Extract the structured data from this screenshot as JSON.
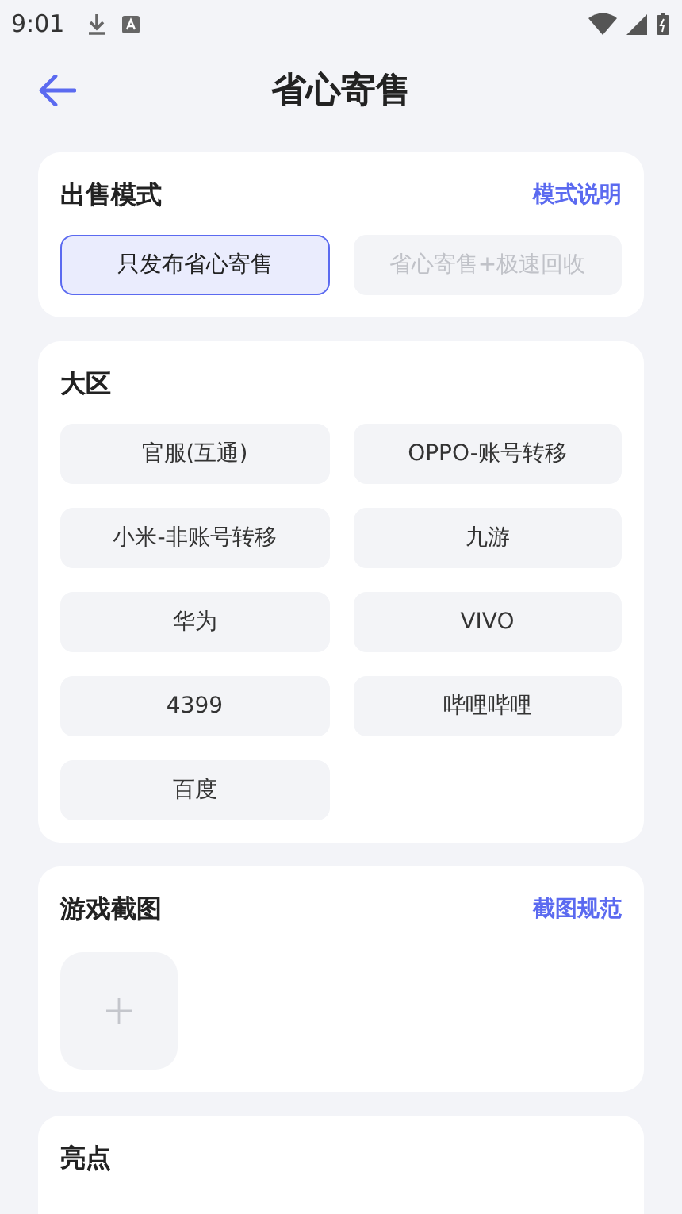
{
  "status_bar": {
    "time": "9:01"
  },
  "header": {
    "title": "省心寄售"
  },
  "sale_mode": {
    "title": "出售模式",
    "link": "模式说明",
    "options": [
      {
        "label": "只发布省心寄售",
        "selected": true
      },
      {
        "label": "省心寄售+极速回收",
        "selected": false
      }
    ]
  },
  "region": {
    "title": "大区",
    "options": [
      {
        "label": "官服(互通)",
        "selected": false
      },
      {
        "label": "OPPO-账号转移",
        "selected": false
      },
      {
        "label": "小米-非账号转移",
        "selected": false
      },
      {
        "label": "九游",
        "selected": false
      },
      {
        "label": "华为",
        "selected": false
      },
      {
        "label": "VIVO",
        "selected": false
      },
      {
        "label": "4399",
        "selected": false
      },
      {
        "label": "哔哩哔哩",
        "selected": false
      },
      {
        "label": "百度",
        "selected": false
      }
    ]
  },
  "screenshots": {
    "title": "游戏截图",
    "link": "截图规范"
  },
  "highlights": {
    "title": "亮点"
  }
}
